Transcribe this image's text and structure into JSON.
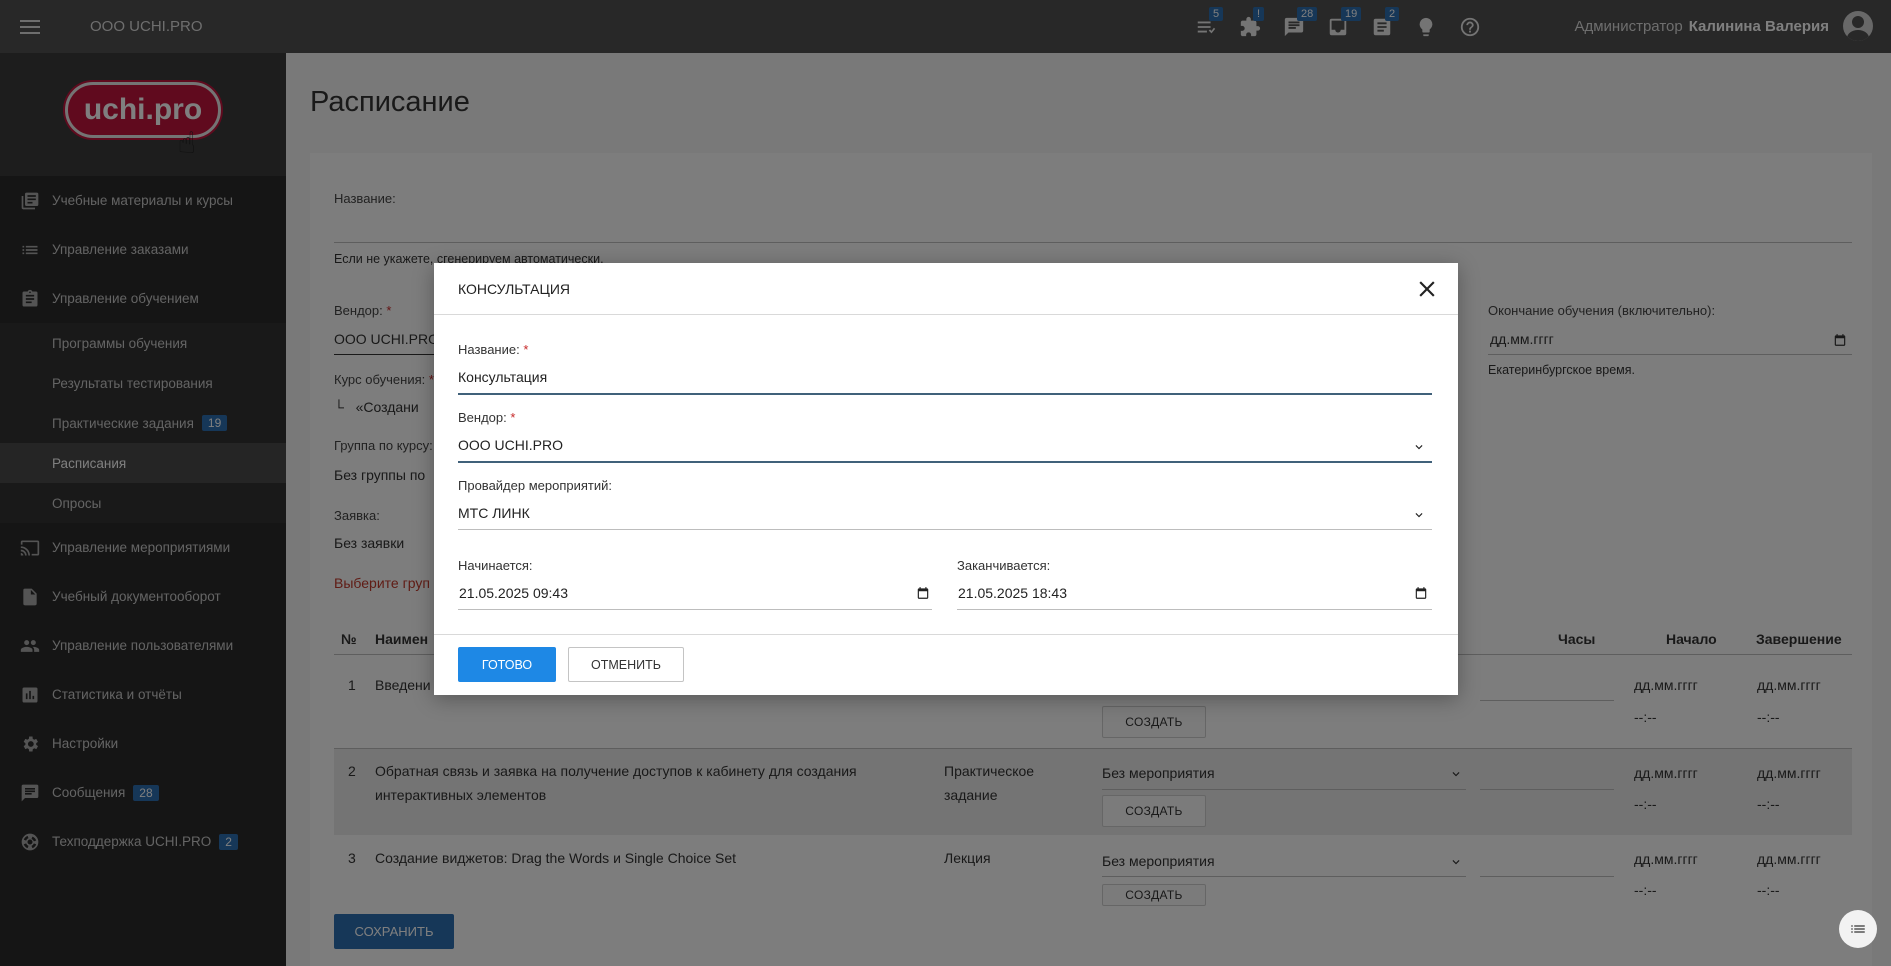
{
  "topbar": {
    "org_name": "ООО UCHI.PRO",
    "icons": [
      {
        "name": "list-icon",
        "badge": "5"
      },
      {
        "name": "puzzle-icon",
        "badge": "!"
      },
      {
        "name": "chat-icon",
        "badge": "28"
      },
      {
        "name": "inbox-icon",
        "badge": "19"
      },
      {
        "name": "document-icon",
        "badge": "2"
      },
      {
        "name": "bulb-icon",
        "badge": ""
      },
      {
        "name": "help-icon",
        "badge": ""
      }
    ],
    "user_role": "Администратор",
    "user_name": "Калинина Валерия"
  },
  "sidebar": {
    "logo_text": "uchi.pro",
    "items": [
      {
        "label": "Учебные материалы и курсы",
        "icon": "book-icon"
      },
      {
        "label": "Управление заказами",
        "icon": "list-icon"
      },
      {
        "label": "Управление обучением",
        "icon": "clipboard-icon"
      },
      {
        "label": "Программы обучения"
      },
      {
        "label": "Результаты тестирования"
      },
      {
        "label": "Практические задания",
        "badge": "19"
      },
      {
        "label": "Расписания"
      },
      {
        "label": "Опросы"
      },
      {
        "label": "Управление мероприятиями",
        "icon": "cast-icon"
      },
      {
        "label": "Учебный документооборот",
        "icon": "file-icon"
      },
      {
        "label": "Управление пользователями",
        "icon": "people-icon"
      },
      {
        "label": "Статистика и отчёты",
        "icon": "chart-icon"
      },
      {
        "label": "Настройки",
        "icon": "gear-icon"
      },
      {
        "label": "Сообщения",
        "icon": "message-icon",
        "badge": "28"
      },
      {
        "label": "Техподдержка UCHI.PRO",
        "icon": "support-icon",
        "badge": "2"
      }
    ]
  },
  "main": {
    "page_title": "Расписание",
    "name_label": "Название:",
    "name_hint": "Если не укажете, сгенерируем автоматически.",
    "vendor_label": "Вендор:",
    "vendor_value": "ООО UCHI.PRO",
    "course_label": "Курс обучения:",
    "course_value": "«Создани",
    "group_label": "Группа по курсу:",
    "group_value": "Без группы по",
    "request_label": "Заявка:",
    "request_value": "Без заявки",
    "error_text": "Выберите груп",
    "end_label": "Окончание обучения (включительно):",
    "end_placeholder": "дд.мм.гггг",
    "timezone_hint": "Екатеринбургское время.",
    "table": {
      "headers": {
        "num": "№",
        "name": "Наимен",
        "hours": "Часы",
        "start": "Начало",
        "end": "Завершение"
      },
      "rows": [
        {
          "num": "1",
          "name": "Введени",
          "type": "",
          "event": "",
          "create": "СОЗДАТЬ"
        },
        {
          "num": "2",
          "name": "Обратная связь и заявка на получение доступов к кабинету для создания интерактивных элементов",
          "type": "Практическое задание",
          "event": "Без мероприятия",
          "create": "СОЗДАТЬ"
        },
        {
          "num": "3",
          "name": "Создание виджетов: Drag the Words и Single Choice Set",
          "type": "Лекция",
          "event": "Без мероприятия",
          "create": "СОЗДАТЬ"
        }
      ],
      "date_placeholder": "дд.мм.гггг",
      "time_placeholder": "--:--"
    },
    "save_label": "СОХРАНИТЬ"
  },
  "modal": {
    "title": "КОНСУЛЬТАЦИЯ",
    "name_label": "Название:",
    "name_value": "Консультация",
    "vendor_label": "Вендор:",
    "vendor_value": "ООО UCHI.PRO",
    "provider_label": "Провайдер мероприятий:",
    "provider_value": "МТС ЛИНК",
    "start_label": "Начинается:",
    "start_value": "21.05.2025 09:43",
    "end_label": "Заканчивается:",
    "end_value": "21.05.2025 18:43",
    "done_label": "ГОТОВО",
    "cancel_label": "ОТМЕНИТЬ",
    "required_mark": "*"
  }
}
